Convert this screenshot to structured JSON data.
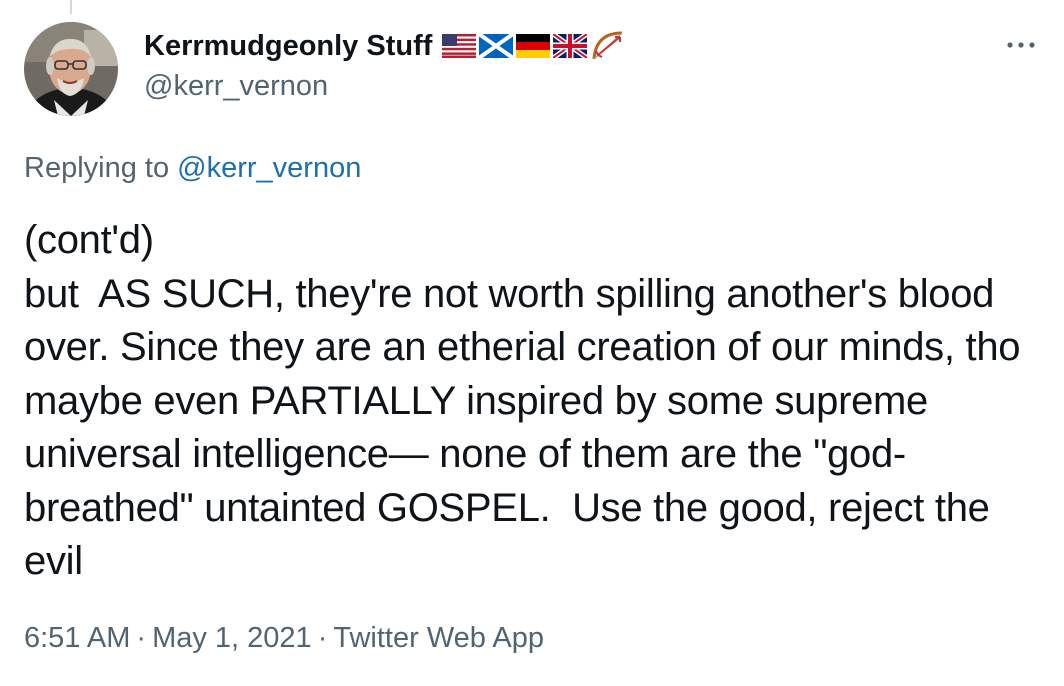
{
  "tweet": {
    "author": {
      "display_name": "Kerrmudgeonly Stuff",
      "handle": "@kerr_vernon",
      "name_emojis": [
        "us-flag-icon",
        "scotland-flag-icon",
        "germany-flag-icon",
        "uk-flag-icon",
        "bow-and-arrow-icon"
      ]
    },
    "replying_prefix": "Replying to",
    "replying_to": "@kerr_vernon",
    "text": "(cont'd)\nbut  AS SUCH, they're not worth spilling another's blood over. Since they are an etherial creation of our minds, tho maybe even PARTIALLY inspired by some supreme universal intelligence— none of them are the \"god-breathed\" untainted GOSPEL.  Use the good, reject the evil",
    "time": "6:51 AM",
    "date": "May 1, 2021",
    "source": "Twitter Web App",
    "separator": "·"
  },
  "colors": {
    "text": "#0f1419",
    "secondary": "#536471",
    "link": "#1d6fb0"
  }
}
